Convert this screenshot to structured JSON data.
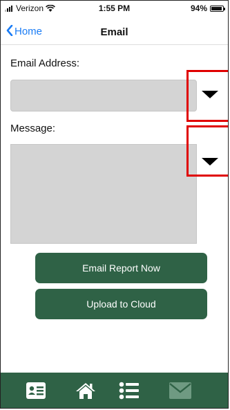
{
  "status_bar": {
    "carrier": "Verizon",
    "time": "1:55 PM",
    "battery": "94%",
    "battery_level": 0.94
  },
  "nav": {
    "back_label": "Home",
    "title": "Email"
  },
  "form": {
    "email_label": "Email Address:",
    "email_value": "",
    "message_label": "Message:",
    "message_value": ""
  },
  "buttons": {
    "email_report": "Email Report Now",
    "upload": "Upload to Cloud"
  },
  "tabbar": {
    "background": "#2f6246",
    "items": [
      {
        "icon": "contact-card-icon",
        "active": true
      },
      {
        "icon": "home-icon",
        "active": true
      },
      {
        "icon": "list-icon",
        "active": true
      },
      {
        "icon": "mail-icon",
        "active": false
      }
    ]
  },
  "colors": {
    "accent_blue": "#1a7cf5",
    "highlight_red": "#e00000",
    "field_gray": "#d4d4d4"
  }
}
